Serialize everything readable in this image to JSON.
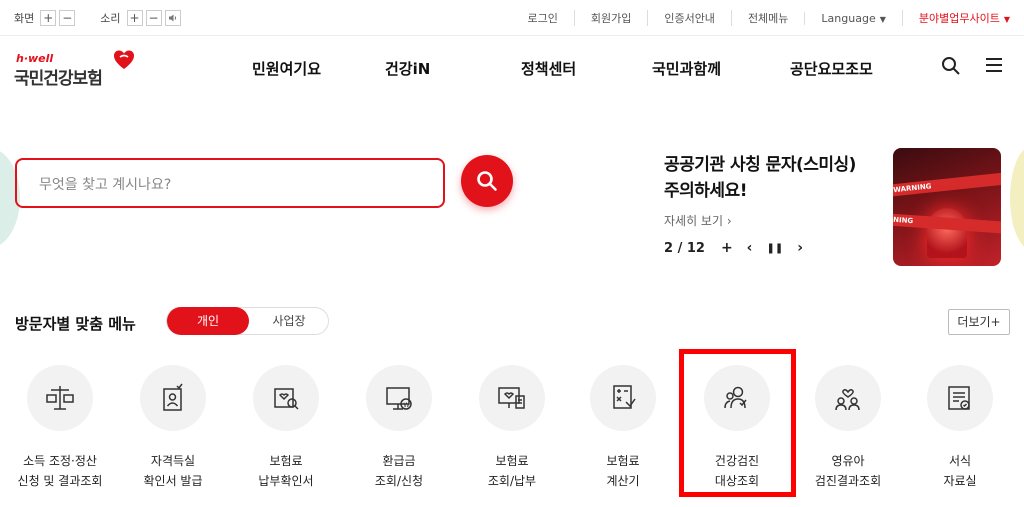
{
  "utility": {
    "screen_label": "화면",
    "sound_label": "소리",
    "plus": "+",
    "minus": "−",
    "links": [
      "로그인",
      "회원가입",
      "인증서안내",
      "전체메뉴"
    ],
    "language": "Language",
    "field_site": "분야별업무사이트",
    "dropdown_arrow": "▼"
  },
  "logo": {
    "tagline": "h·well",
    "name": "국민건강보험"
  },
  "gnb": {
    "items": [
      "민원여기요",
      "건강iN",
      "정책센터",
      "국민과함께",
      "공단요모조모"
    ]
  },
  "search": {
    "placeholder": "무엇을 찾고 계시나요?"
  },
  "notice": {
    "title_line1": "공공기관 사칭 문자(스미싱)",
    "title_line2": "주의하세요!",
    "more": "자세히 보기 ›",
    "page": "2 / 12",
    "add": "+",
    "prev": "‹",
    "pause": "❚❚",
    "next": "›",
    "banner_text1": "WARNING",
    "banner_text2": "NING"
  },
  "custom_menu": {
    "title": "방문자별 맞춤 메뉴",
    "tab_personal": "개인",
    "tab_business": "사업장",
    "more": "더보기+"
  },
  "services": [
    {
      "l1": "소득 조정·정산",
      "l2": "신청 및 결과조회",
      "icon": "scale-icon"
    },
    {
      "l1": "자격득실",
      "l2": "확인서 발급",
      "icon": "id-card-icon"
    },
    {
      "l1": "보험료",
      "l2": "납부확인서",
      "icon": "document-search-icon"
    },
    {
      "l1": "환급금",
      "l2": "조회/신청",
      "icon": "monitor-won-icon"
    },
    {
      "l1": "보험료",
      "l2": "조회/납부",
      "icon": "monitor-receipt-icon"
    },
    {
      "l1": "보험료",
      "l2": "계산기",
      "icon": "calculator-icon"
    },
    {
      "l1": "건강검진",
      "l2": "대상조회",
      "icon": "people-icon"
    },
    {
      "l1": "영유아",
      "l2": "검진결과조회",
      "icon": "family-icon"
    },
    {
      "l1": "서식",
      "l2": "자료실",
      "icon": "form-icon"
    }
  ],
  "colors": {
    "brand_red": "#e2121b",
    "highlight": "#ff0000"
  }
}
